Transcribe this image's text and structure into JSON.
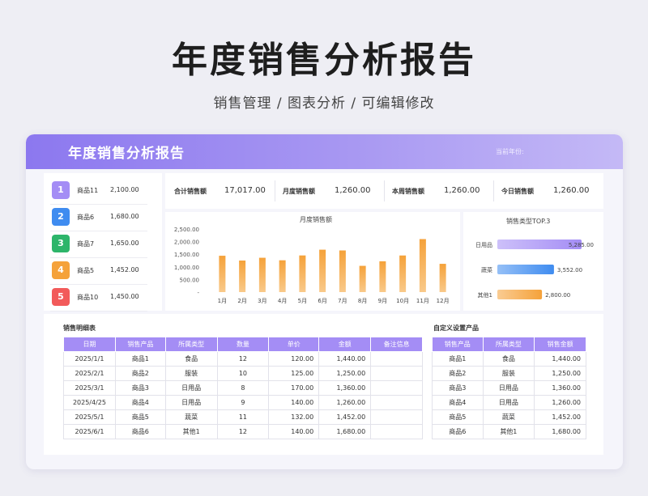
{
  "header": {
    "title": "年度销售分析报告",
    "subtitle": "销售管理 / 图表分析 /  可编辑修改"
  },
  "dashboard": {
    "banner_title": "年度销售分析报告",
    "banner_right": "当前年份:"
  },
  "ranking": [
    {
      "rank": "1",
      "name": "商品11",
      "value": "2,100.00",
      "color": "#a48df5"
    },
    {
      "rank": "2",
      "name": "商品6",
      "value": "1,680.00",
      "color": "#3f8cf0"
    },
    {
      "rank": "3",
      "name": "商品7",
      "value": "1,650.00",
      "color": "#2db56a"
    },
    {
      "rank": "4",
      "name": "商品5",
      "value": "1,452.00",
      "color": "#f5a23a"
    },
    {
      "rank": "5",
      "name": "商品10",
      "value": "1,450.00",
      "color": "#f25a5a"
    }
  ],
  "stats": [
    {
      "label": "合计销售额",
      "value": "17,017.00"
    },
    {
      "label": "月度销售额",
      "value": "1,260.00"
    },
    {
      "label": "本周销售额",
      "value": "1,260.00"
    },
    {
      "label": "今日销售额",
      "value": "1,260.00"
    }
  ],
  "chart_data": [
    {
      "type": "bar",
      "title": "月度销售额",
      "categories": [
        "1月",
        "2月",
        "3月",
        "4月",
        "5月",
        "6月",
        "7月",
        "8月",
        "9月",
        "10月",
        "11月",
        "12月"
      ],
      "values": [
        1440,
        1250,
        1360,
        1260,
        1452,
        1680,
        1650,
        1040,
        1220,
        1450,
        2100,
        1120
      ],
      "ylim": [
        0,
        2500
      ],
      "yticks": [
        "2,500.00",
        "2,000.00",
        "1,500.00",
        "1,000.00",
        "500.00",
        "-"
      ],
      "color": "#f5a23a"
    },
    {
      "type": "bar",
      "title": "销售类型TOP.3",
      "categories": [
        "日用品",
        "蔬菜",
        "其他1"
      ],
      "values": [
        5285,
        3552,
        2800
      ],
      "labels": [
        "5,285.00",
        "3,552.00",
        "2,800.00"
      ],
      "colors": [
        "#a48df5",
        "#3f8cf0",
        "#f5a23a"
      ],
      "xlim": [
        0,
        5285
      ]
    }
  ],
  "detail_table": {
    "title": "销售明细表",
    "headers": [
      "日期",
      "销售产品",
      "所属类型",
      "数量",
      "单价",
      "金额",
      "备注信息"
    ],
    "rows": [
      [
        "2025/1/1",
        "商品1",
        "食品",
        "12",
        "120.00",
        "1,440.00",
        ""
      ],
      [
        "2025/2/1",
        "商品2",
        "服装",
        "10",
        "125.00",
        "1,250.00",
        ""
      ],
      [
        "2025/3/1",
        "商品3",
        "日用品",
        "8",
        "170.00",
        "1,360.00",
        ""
      ],
      [
        "2025/4/25",
        "商品4",
        "日用品",
        "9",
        "140.00",
        "1,260.00",
        ""
      ],
      [
        "2025/5/1",
        "商品5",
        "蔬菜",
        "11",
        "132.00",
        "1,452.00",
        ""
      ],
      [
        "2025/6/1",
        "商品6",
        "其他1",
        "12",
        "140.00",
        "1,680.00",
        ""
      ]
    ]
  },
  "custom_table": {
    "title": "自定义设置产品",
    "headers": [
      "销售产品",
      "所属类型",
      "销售金额"
    ],
    "rows": [
      [
        "商品1",
        "食品",
        "1,440.00"
      ],
      [
        "商品2",
        "服装",
        "1,250.00"
      ],
      [
        "商品3",
        "日用品",
        "1,360.00"
      ],
      [
        "商品4",
        "日用品",
        "1,260.00"
      ],
      [
        "商品5",
        "蔬菜",
        "1,452.00"
      ],
      [
        "商品6",
        "其他1",
        "1,680.00"
      ]
    ]
  }
}
